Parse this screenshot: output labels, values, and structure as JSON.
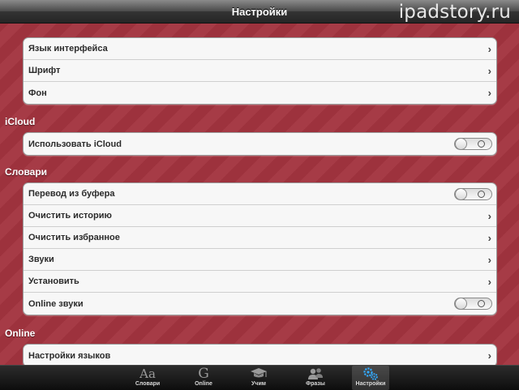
{
  "app": {
    "title": "Настройки",
    "watermark": "ipadstory.ru"
  },
  "groups": {
    "general": {
      "rows": [
        {
          "label": "Язык интерфейса"
        },
        {
          "label": "Шрифт"
        },
        {
          "label": "Фон"
        }
      ]
    },
    "icloud": {
      "title": "iCloud",
      "rows": [
        {
          "label": "Использовать iCloud",
          "toggle_on": false
        }
      ]
    },
    "dictionaries": {
      "title": "Словари",
      "rows": [
        {
          "label": "Перевод из буфера",
          "toggle_on": false
        },
        {
          "label": "Очистить историю"
        },
        {
          "label": "Очистить избранное"
        },
        {
          "label": "Звуки"
        },
        {
          "label": "Установить"
        },
        {
          "label": "Online звуки",
          "toggle_on": false
        }
      ]
    },
    "online": {
      "title": "Online",
      "rows": [
        {
          "label": "Настройки языков"
        }
      ]
    }
  },
  "tabbar": {
    "tabs": [
      {
        "label": "Словари",
        "icon": "dictionary-icon",
        "glyph": "Aa",
        "active": false
      },
      {
        "label": "Online",
        "icon": "google-icon",
        "glyph": "G",
        "active": false
      },
      {
        "label": "Учим",
        "icon": "graduation-cap-icon",
        "active": false
      },
      {
        "label": "Фразы",
        "icon": "people-icon",
        "active": false
      },
      {
        "label": "Настройки",
        "icon": "gears-icon",
        "active": true
      }
    ]
  },
  "colors": {
    "background": "#a3343f",
    "accent_active_icon": "#33aaff"
  }
}
